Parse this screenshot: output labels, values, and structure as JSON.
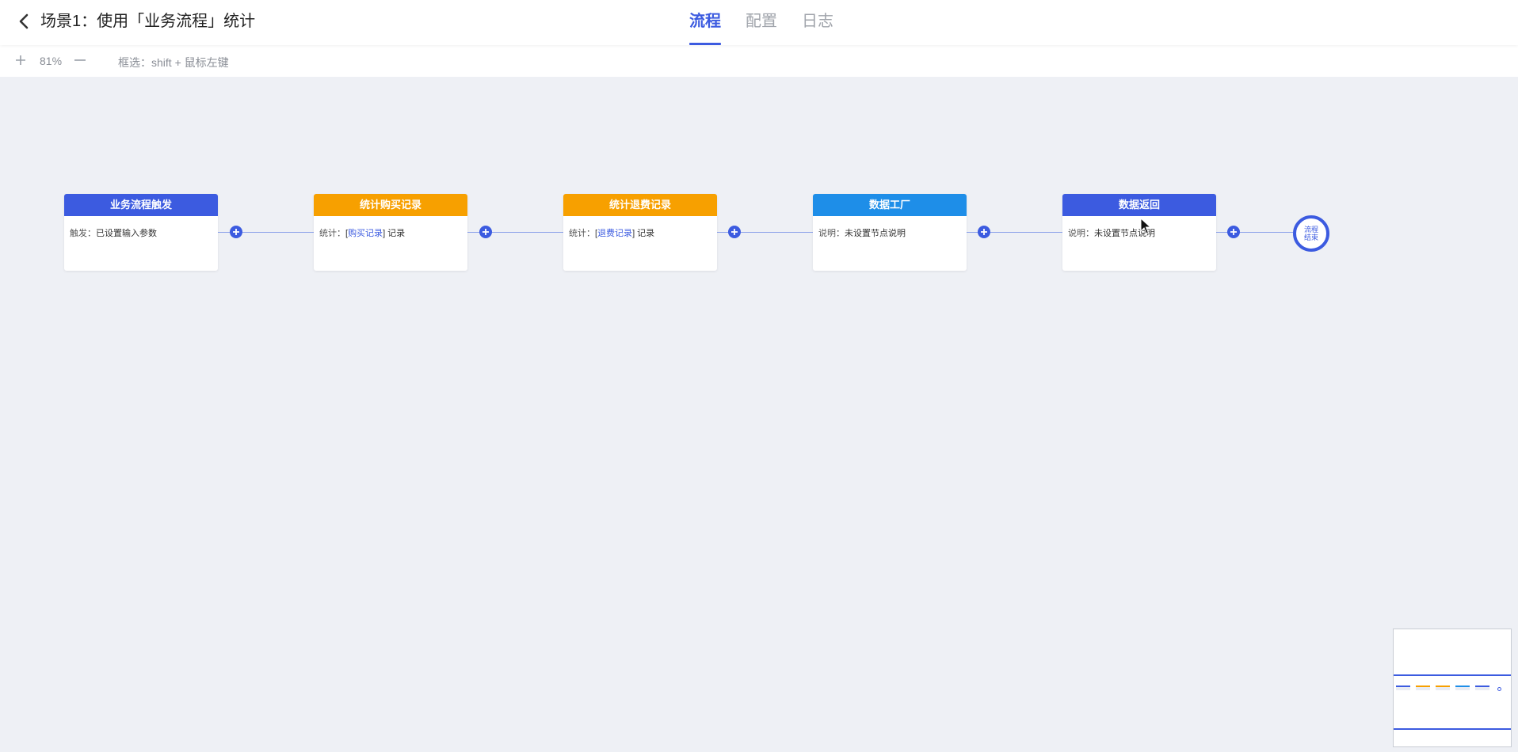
{
  "header": {
    "title": "场景1：使用「业务流程」统计",
    "tabs": [
      {
        "label": "流程",
        "active": true
      },
      {
        "label": "配置",
        "active": false
      },
      {
        "label": "日志",
        "active": false
      }
    ]
  },
  "toolbar": {
    "zoom": "81%",
    "hint": "框选：shift + 鼠标左键"
  },
  "colors": {
    "primary": "#3c5be0",
    "orange": "#f7a000",
    "sky": "#1e8ee8"
  },
  "nodes": [
    {
      "title": "业务流程触发",
      "label": "触发：",
      "text": "已设置输入参数",
      "color": "#3c5be0"
    },
    {
      "title": "统计购买记录",
      "label": "统计：",
      "pre": "[",
      "link": "购买记录",
      "post": "] 记录",
      "color": "#f7a000"
    },
    {
      "title": "统计退费记录",
      "label": "统计：",
      "pre": "[",
      "link": "退费记录",
      "post": "] 记录",
      "color": "#f7a000"
    },
    {
      "title": "数据工厂",
      "label": "说明：",
      "text": "未设置节点说明",
      "color": "#1e8ee8"
    },
    {
      "title": "数据返回",
      "label": "说明：",
      "text": "未设置节点说明",
      "color": "#3c5be0"
    }
  ],
  "end_node": {
    "line1": "流程",
    "line2": "结束"
  }
}
